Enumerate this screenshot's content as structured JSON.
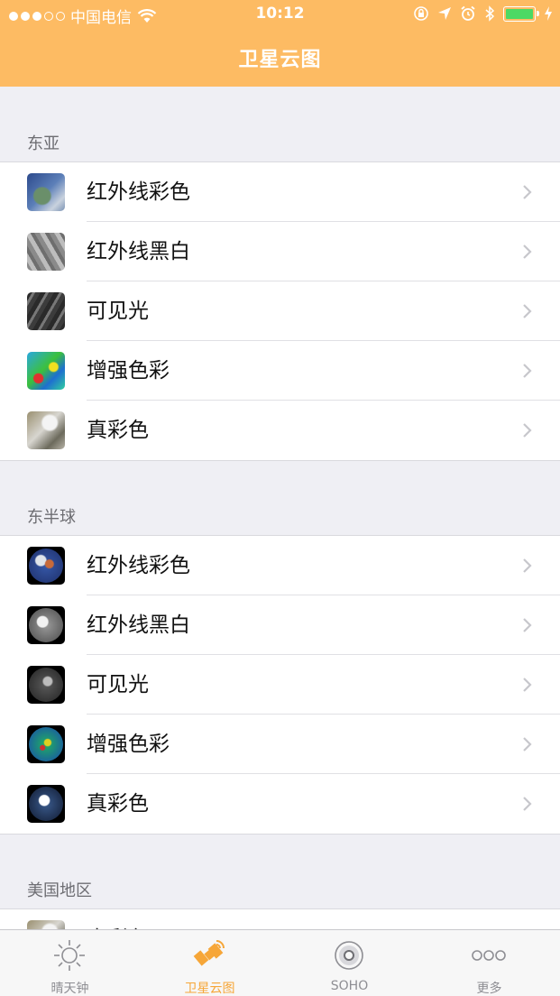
{
  "status_bar": {
    "carrier": "中国电信",
    "time": "10:12"
  },
  "nav": {
    "title": "卫星云图"
  },
  "sections": [
    {
      "header": "东亚",
      "items": [
        {
          "label": "红外线彩色"
        },
        {
          "label": "红外线黑白"
        },
        {
          "label": "可见光"
        },
        {
          "label": "增强色彩"
        },
        {
          "label": "真彩色"
        }
      ]
    },
    {
      "header": "东半球",
      "items": [
        {
          "label": "红外线彩色"
        },
        {
          "label": "红外线黑白"
        },
        {
          "label": "可见光"
        },
        {
          "label": "增强色彩"
        },
        {
          "label": "真彩色"
        }
      ]
    },
    {
      "header": "美国地区",
      "items": [
        {
          "label": "真彩色"
        }
      ]
    }
  ],
  "tabbar": {
    "tabs": [
      {
        "label": "晴天钟",
        "icon": "sun-icon"
      },
      {
        "label": "卫星云图",
        "icon": "satellite-icon"
      },
      {
        "label": "SOHO",
        "icon": "soho-icon"
      },
      {
        "label": "更多",
        "icon": "more-icon"
      }
    ],
    "active_color": "#f6a638",
    "inactive_color": "#8e8e93"
  },
  "colors": {
    "header": "#fdbb63",
    "background": "#efeff4"
  }
}
